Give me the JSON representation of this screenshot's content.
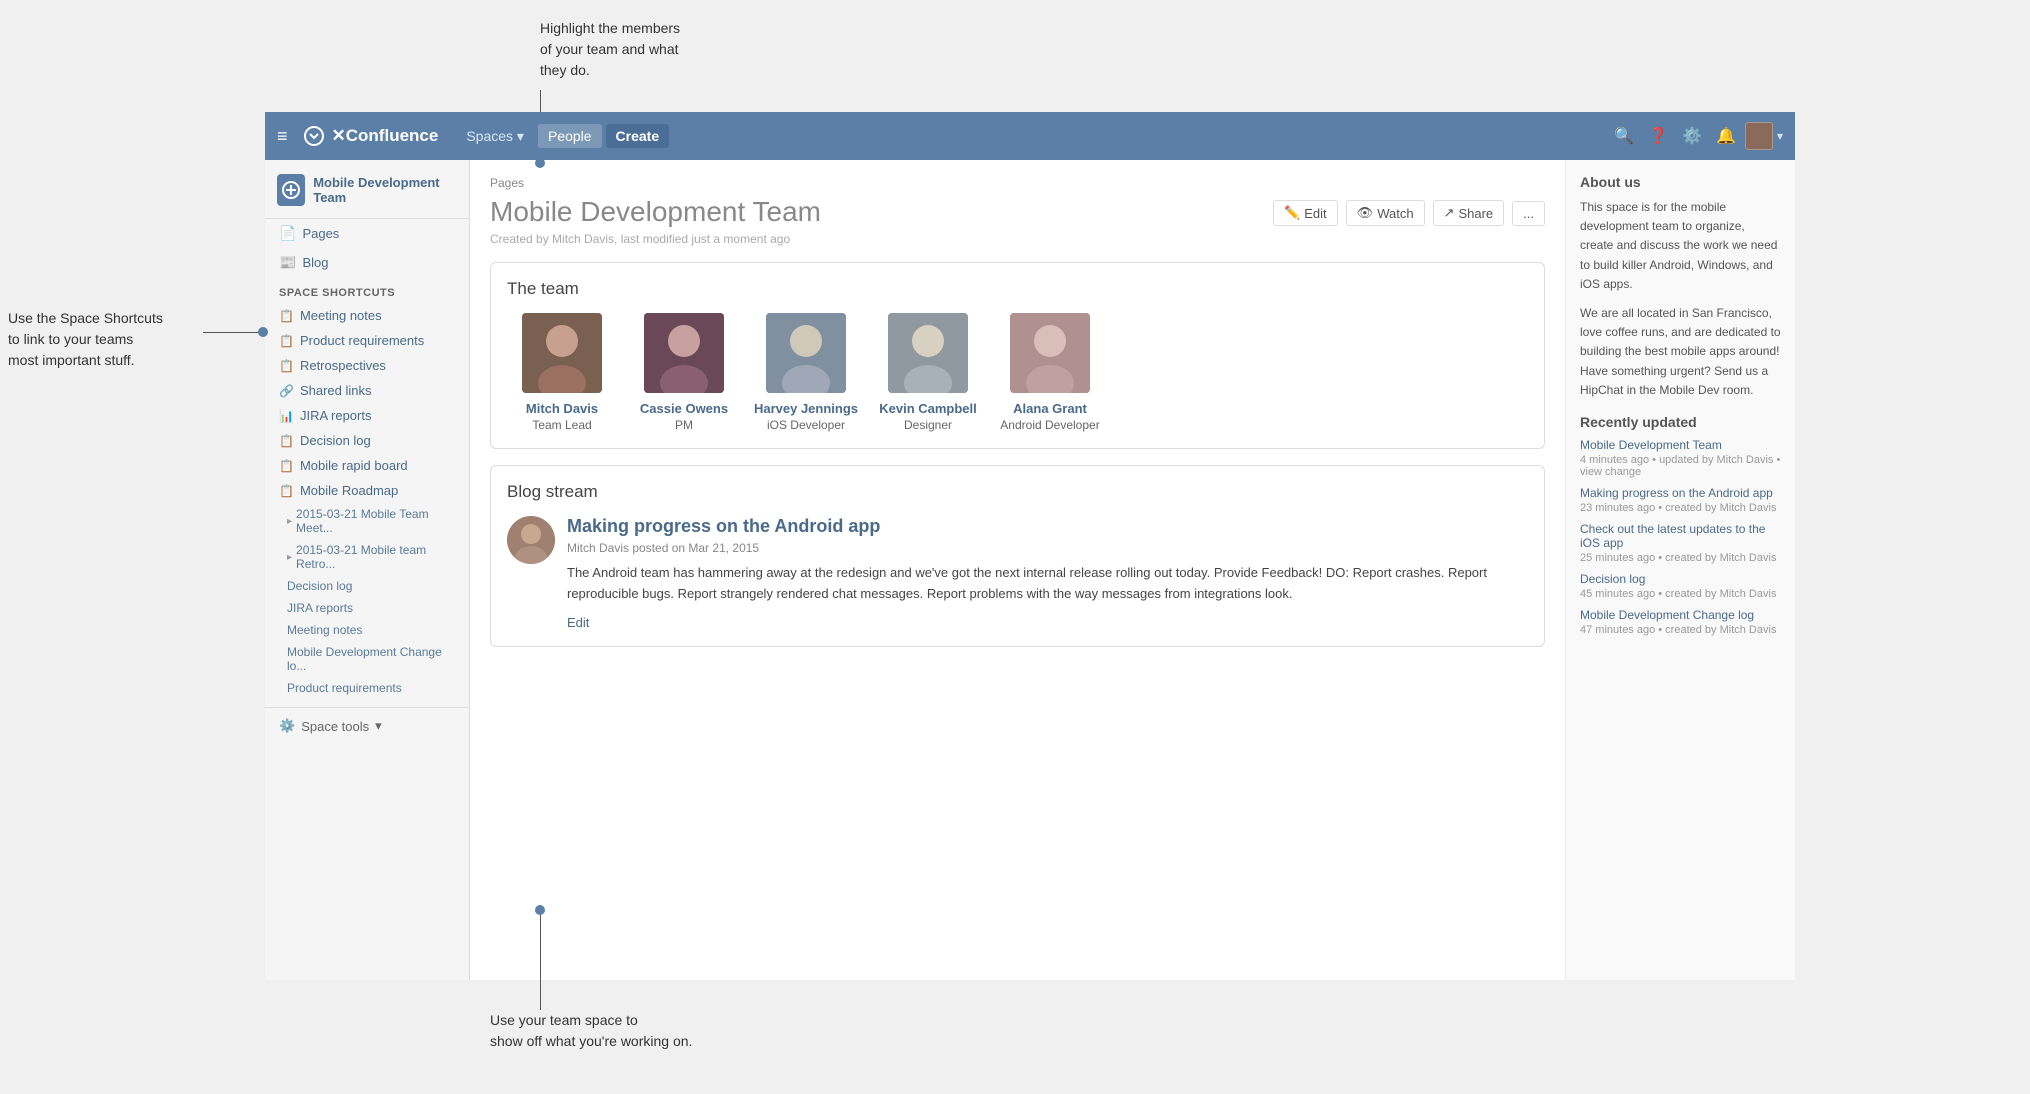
{
  "topnav": {
    "hamburger": "≡",
    "logo": "✕Confluence",
    "items": [
      {
        "label": "Spaces",
        "active": false,
        "hasDropdown": true
      },
      {
        "label": "People",
        "active": false
      },
      {
        "label": "Create",
        "active": false
      }
    ],
    "icons": [
      "search",
      "help",
      "settings",
      "notifications",
      "avatar"
    ]
  },
  "sidebar": {
    "spaceName": "Mobile Development Team",
    "navItems": [
      {
        "icon": "📄",
        "label": "Pages"
      },
      {
        "icon": "📰",
        "label": "Blog"
      }
    ],
    "sectionLabel": "SPACE SHORTCUTS",
    "shortcuts": [
      {
        "icon": "📋",
        "label": "Meeting notes"
      },
      {
        "icon": "📋",
        "label": "Product requirements"
      },
      {
        "icon": "📋",
        "label": "Retrospectives"
      },
      {
        "icon": "🔗",
        "label": "Shared links"
      },
      {
        "icon": "📊",
        "label": "JIRA reports"
      },
      {
        "icon": "📋",
        "label": "Decision log"
      },
      {
        "icon": "📋",
        "label": "Mobile rapid board"
      },
      {
        "icon": "📋",
        "label": "Mobile Roadmap"
      }
    ],
    "treeItems": [
      {
        "label": "2015-03-21 Mobile Team Meet...",
        "arrow": "▸"
      },
      {
        "label": "2015-03-21 Mobile team Retro...",
        "arrow": "▸"
      },
      {
        "label": "Decision log"
      },
      {
        "label": "JIRA reports"
      },
      {
        "label": "Meeting notes"
      },
      {
        "label": "Mobile Development Change lo..."
      },
      {
        "label": "Product requirements"
      }
    ],
    "toolsLabel": "Space tools"
  },
  "page": {
    "breadcrumb": "Pages",
    "title": "Mobile Development Team",
    "meta": "Created by Mitch Davis, last modified just a moment ago",
    "actions": {
      "edit": "Edit",
      "watch": "Watch",
      "share": "Share",
      "more": "..."
    }
  },
  "team": {
    "sectionTitle": "The team",
    "members": [
      {
        "name": "Mitch Davis",
        "role": "Team Lead",
        "color": "#7a6050"
      },
      {
        "name": "Cassie Owens",
        "role": "PM",
        "color": "#6a5060"
      },
      {
        "name": "Harvey Jennings",
        "role": "iOS Developer",
        "color": "#8090a0"
      },
      {
        "name": "Kevin Campbell",
        "role": "Designer",
        "color": "#9098a0"
      },
      {
        "name": "Alana Grant",
        "role": "Android Developer",
        "color": "#b09090"
      }
    ]
  },
  "blog": {
    "sectionTitle": "Blog stream",
    "post": {
      "title": "Making progress on the Android app",
      "author": "Mitch Davis",
      "date": "Mar 21, 2015",
      "meta": "Mitch Davis posted on Mar 21, 2015",
      "body": "The Android team has hammering away at the redesign and we've got the next internal release rolling out today. Provide Feedback! DO: Report crashes. Report reproducible bugs. Report strangely rendered chat messages. Report problems with the way messages from integrations look.",
      "editLabel": "Edit"
    }
  },
  "rightSidebar": {
    "aboutTitle": "About us",
    "aboutText1": "This space is for the mobile development team to organize, create and discuss the work we need to build killer Android, Windows, and iOS apps.",
    "aboutText2": "We are all located in San Francisco, love coffee runs, and are dedicated to building the best mobile apps around! Have something urgent? Send us a HipChat in the Mobile Dev room.",
    "recentTitle": "Recently updated",
    "recentItems": [
      {
        "title": "Mobile Development Team",
        "meta": "4 minutes ago • updated by Mitch Davis • view change"
      },
      {
        "title": "Making progress on the Android app",
        "meta": "23 minutes ago • created by Mitch Davis"
      },
      {
        "title": "Check out the latest updates to the iOS app",
        "meta": "25 minutes ago • created by Mitch Davis"
      },
      {
        "title": "Decision log",
        "meta": "45 minutes ago • created by Mitch Davis"
      },
      {
        "title": "Mobile Development Change log",
        "meta": "47 minutes ago • created by Mitch Davis"
      }
    ]
  },
  "annotations": {
    "topCallout": "Highlight the members\nof your team and what\nthey do.",
    "leftCallout": "Use the Space Shortcuts\nto link to your teams\nmost important stuff.",
    "bottomCallout": "Use your team space to\nshow off what you're working on."
  }
}
